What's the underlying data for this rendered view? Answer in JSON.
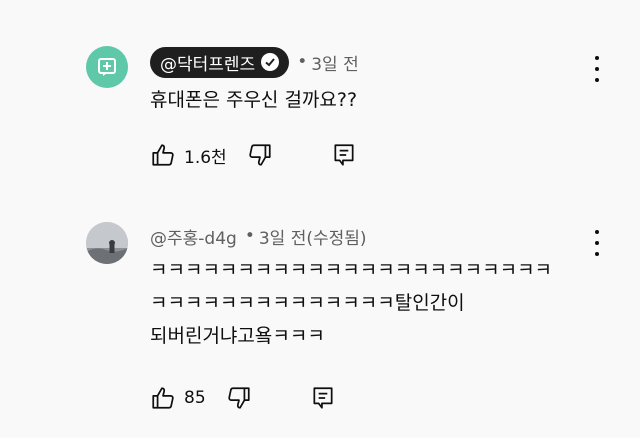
{
  "comments": [
    {
      "author": "@닥터프렌즈",
      "verified": true,
      "sep": "•",
      "time": "3일 전",
      "lines": [
        "휴대폰은 주우신 걸까요??"
      ],
      "likes": "1.6천",
      "avatar_color": "#5ec8a8"
    },
    {
      "author": "@주홍-d4g",
      "verified": false,
      "sep": "•",
      "time": "3일 전(수정됨)",
      "lines": [
        "ㅋㅋㅋㅋㅋㅋㅋㅋㅋㅋㅋㅋㅋㅋㅋㅋㅋㅋㅋㅋㅋㅋㅋ",
        "ㅋㅋㅋㅋㅋㅋㅋㅋㅋㅋㅋㅋㅋㅋ탈인간이",
        "되버린거냐고욬ㅋㅋㅋ"
      ],
      "likes": "85"
    }
  ],
  "icons": {
    "like": "thumbs-up-icon",
    "dislike": "thumbs-down-icon",
    "reply": "reply-icon",
    "more": "more-vertical-icon",
    "verified": "verified-check-icon"
  }
}
